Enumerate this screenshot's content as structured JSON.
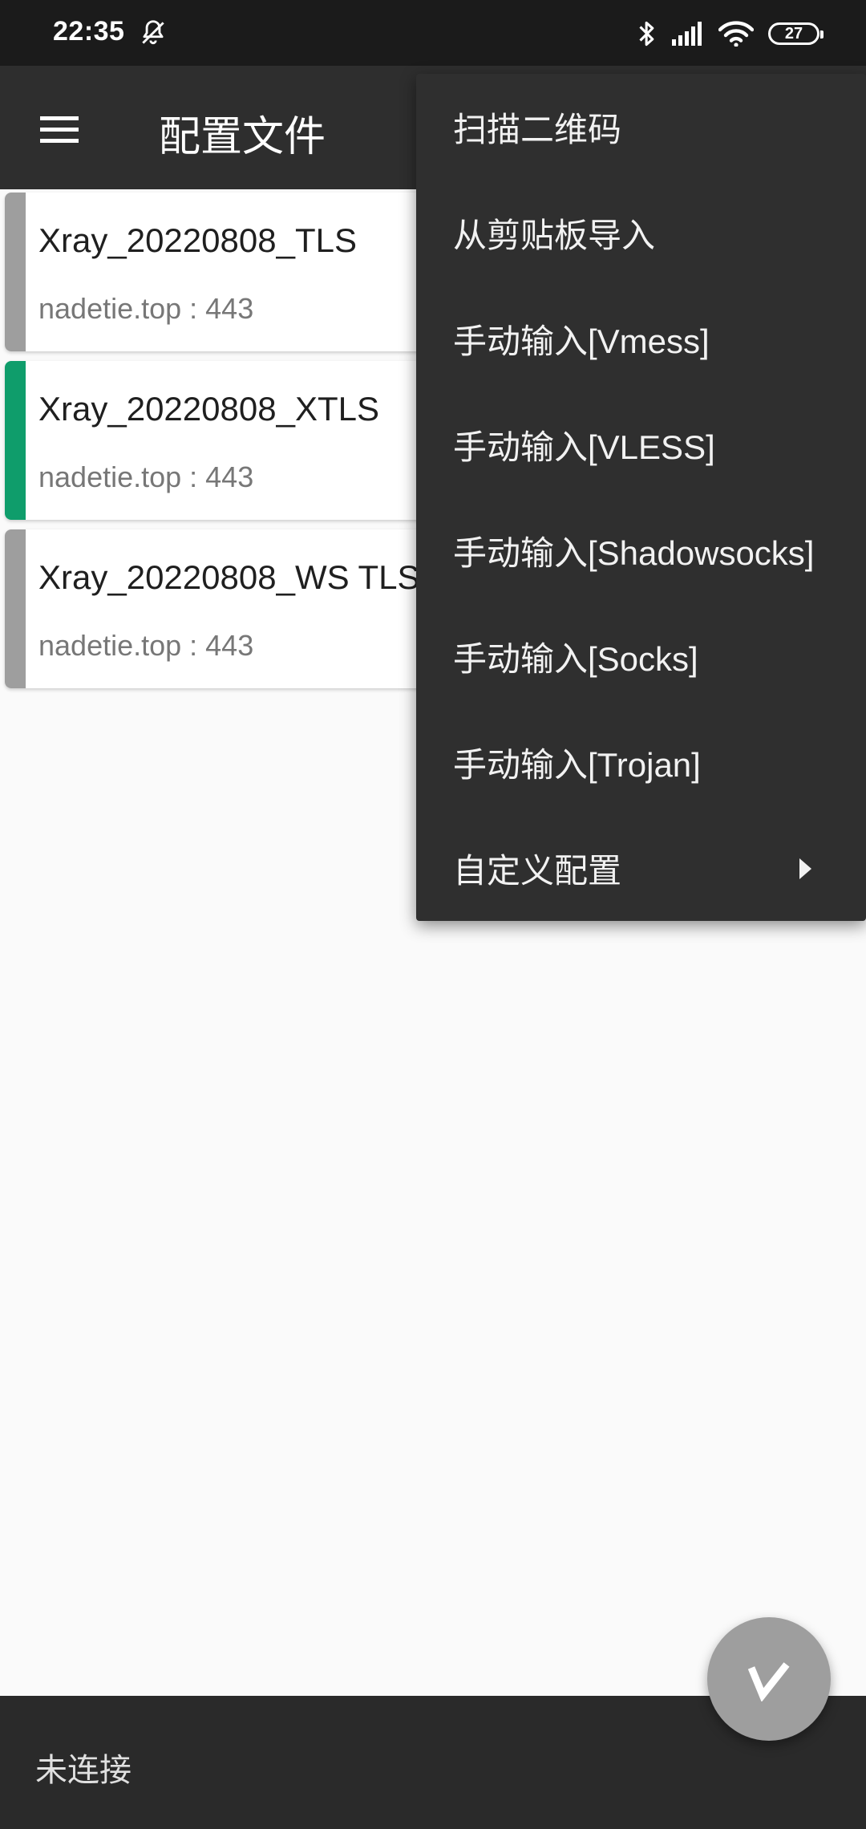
{
  "status_bar": {
    "time": "22:35",
    "battery": "27",
    "icons": [
      "bell-off-icon",
      "bluetooth-icon",
      "signal-icon",
      "wifi-icon",
      "battery-icon"
    ]
  },
  "app_bar": {
    "title": "配置文件",
    "menu_icon": "hamburger-menu-icon"
  },
  "profiles": [
    {
      "name": "Xray_20220808_TLS",
      "address": "nadetie.top : 443",
      "selected": false,
      "indicator_color": "#9e9e9e"
    },
    {
      "name": "Xray_20220808_XTLS",
      "address": "nadetie.top : 443",
      "selected": true,
      "indicator_color": "#0f9d6b"
    },
    {
      "name": "Xray_20220808_WS TLS",
      "address": "nadetie.top : 443",
      "selected": false,
      "indicator_color": "#9e9e9e"
    }
  ],
  "popup_menu": {
    "items": [
      "扫描二维码",
      "从剪贴板导入",
      "手动输入[Vmess]",
      "手动输入[VLESS]",
      "手动输入[Shadowsocks]",
      "手动输入[Socks]",
      "手动输入[Trojan]",
      "自定义配置"
    ],
    "submenu_icon": "chevron-right-icon"
  },
  "bottom_bar": {
    "status": "未连接"
  },
  "fab": {
    "icon": "v-logo-icon"
  },
  "colors": {
    "status_bar_bg": "#1b1b1b",
    "app_bar_bg": "#2e2e2e",
    "menu_bg": "#2f2f2f",
    "selected_indicator": "#0f9d6b",
    "unselected_indicator": "#9e9e9e",
    "fab_bg": "#9e9e9e"
  }
}
